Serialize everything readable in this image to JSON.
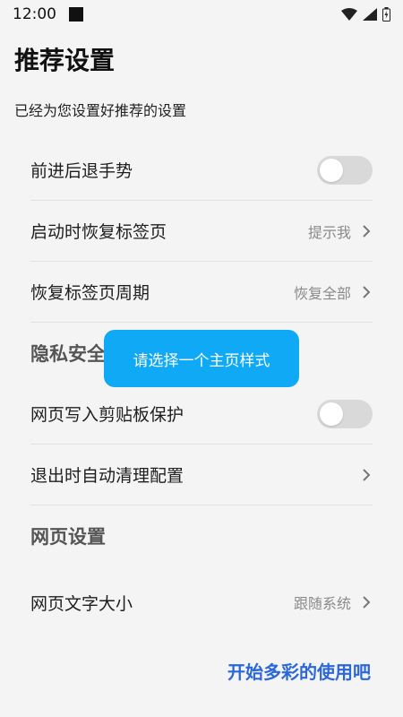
{
  "status": {
    "time": "12:00"
  },
  "page": {
    "title": "推荐设置",
    "subtitle": "已经为您设置好推荐的设置"
  },
  "rows": {
    "gesture": {
      "label": "前进后退手势",
      "toggle_on": false
    },
    "restore_on_start": {
      "label": "启动时恢复标签页",
      "value": "提示我"
    },
    "restore_period": {
      "label": "恢复标签页周期",
      "value": "恢复全部"
    },
    "privacy_section": {
      "label": "隐私安全"
    },
    "clipboard_protect": {
      "label": "网页写入剪贴板保护",
      "toggle_on": false
    },
    "auto_clean": {
      "label": "退出时自动清理配置"
    },
    "web_section": {
      "label": "网页设置"
    },
    "font_size": {
      "label": "网页文字大小",
      "value": "跟随系统"
    }
  },
  "toast": {
    "text": "请选择一个主页样式"
  },
  "cta": {
    "label": "开始多彩的使用吧"
  },
  "colors": {
    "accent_blue": "#2b67d8",
    "toast_bg": "#10a9f5",
    "toggle_off": "#d9d9d9"
  }
}
